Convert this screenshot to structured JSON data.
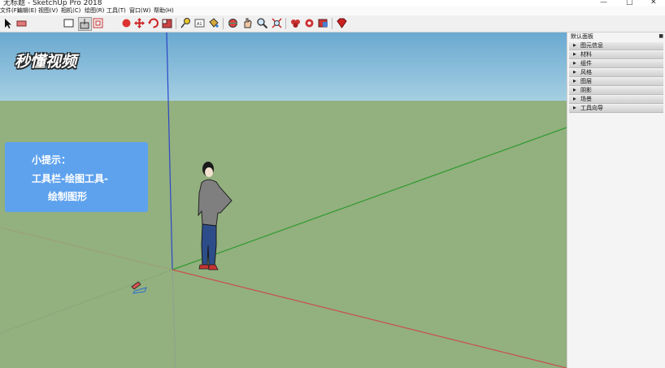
{
  "titlebar": {
    "title": "无标题 - SketchUp Pro 2018"
  },
  "menu": [
    {
      "label": "文件(F)"
    },
    {
      "label": "编辑(E)"
    },
    {
      "label": "视图(V)"
    },
    {
      "label": "相机(C)"
    },
    {
      "label": "绘图(R)"
    },
    {
      "label": "工具(T)"
    },
    {
      "label": "窗口(W)"
    },
    {
      "label": "帮助(H)"
    }
  ],
  "watermark": {
    "text": "秒懂视频"
  },
  "hint": {
    "line1": "小提示：",
    "line2": "工具栏-绘图工具-",
    "line3": "绘制图形"
  },
  "tray": {
    "title": "默认面板",
    "panels": [
      "图元信息",
      "材料",
      "组件",
      "风格",
      "图层",
      "阴影",
      "场景",
      "工具向导"
    ]
  },
  "colors": {
    "sky": "#8dbed7",
    "ground": "#93b07f",
    "axis_red": "#c8504a",
    "axis_green": "#2f9a2f",
    "axis_blue": "#2b47c8",
    "hint_bg": "#5ea2ee"
  }
}
